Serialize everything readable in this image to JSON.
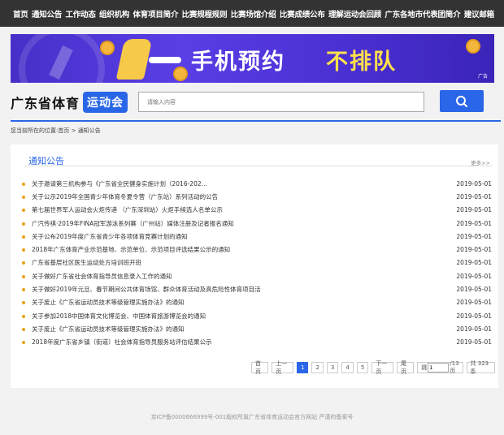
{
  "nav": [
    "首页",
    "通知公告",
    "工作动态",
    "组织机构",
    "体育项目简介",
    "比赛规程规则",
    "比赛场馆介绍",
    "比赛成绩公布",
    "理解运动会回顾",
    "广东各地市代表团简介",
    "建议邮箱"
  ],
  "banner": {
    "text_white": "手机预约",
    "text_yellow": "不排队",
    "small": "广告"
  },
  "logo": {
    "text1": "广东省体育",
    "text2": "运动会"
  },
  "search": {
    "placeholder": "请输入内容",
    "button_icon": "search-icon"
  },
  "breadcrumb": {
    "prefix": "您当前所在的位置:",
    "home": "首页",
    "sep": " > ",
    "current": "通知公告"
  },
  "panel": {
    "title": "通知公告",
    "more": "更多>>"
  },
  "notices": [
    {
      "title": "关于邀请第三机构参与《广东省全民健身实施计划（2016-202...",
      "date": "2019-05-01"
    },
    {
      "title": "关于公示2019年全国青少年体育冬夏令营（广东站）系列活动的公告",
      "date": "2019-05-01"
    },
    {
      "title": "第七届世界军人运动会火炬传递 （广东深圳站）火炬手候选人名单公示",
      "date": "2019-05-01"
    },
    {
      "title": "广汽传祺·2019年FINA冠军游泳系列赛（广州站）媒体注册及记者报名通知",
      "date": "2019-05-01"
    },
    {
      "title": "关于公布2019年度广东省青少年各项体育竞赛计划的通知",
      "date": "2019-05-01"
    },
    {
      "title": "2018年广东体育产业示范基地、示范单位、示范项目评选结果公示的通知",
      "date": "2019-05-01"
    },
    {
      "title": "广东省基层社区医生运动处方培训班开班",
      "date": "2019-05-01"
    },
    {
      "title": "关于做好广东省社会体育指导员信息录入工作的通知",
      "date": "2019-05-01"
    },
    {
      "title": "关于做好2019年元旦、春节期间公共体育场馆、群众体育活动及高危险性体育项目活",
      "date": "2019-05-01"
    },
    {
      "title": "关于废止《广东省运动员技术等级管理实施办法》的通知",
      "date": "2019-05-01"
    },
    {
      "title": "关于参加2018中国体育文化博览会、中国体育旅游博览会的通知",
      "date": "2019-05-01"
    },
    {
      "title": "关于废止《广东省运动员技术等级管理实施办法》的通知",
      "date": "2019-05-01"
    },
    {
      "title": "2018年度广东省乡镇（街道）社会体育指导员服务站评估结果公示",
      "date": "2019-05-01"
    }
  ],
  "pager": {
    "first": "首页",
    "prev": "上一页",
    "pages": [
      "1",
      "2",
      "3",
      "4",
      "5"
    ],
    "next": "下一页",
    "last": "尾页",
    "jump_prefix": "跳",
    "jump_value": "1",
    "jump_suffix": "/13页",
    "total": "共 323 条"
  },
  "footer": "京ICP备0000666999号-001版权所属广东省体育运动会官方网站 严谨的备案号",
  "colors": {
    "accent": "#2a66e8",
    "nav_bg": "#333333",
    "dot": "#e8a317"
  }
}
